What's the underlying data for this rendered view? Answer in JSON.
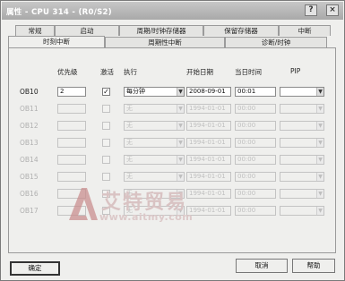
{
  "window": {
    "title": "属性 - CPU 314 - (R0/S2)"
  },
  "tabs_back": [
    "常规",
    "启动",
    "周期/时钟存储器",
    "保留存储器",
    "中断"
  ],
  "tabs_front": [
    "时刻中断",
    "周期性中断",
    "诊断/时钟"
  ],
  "headers": {
    "priority": "优先级",
    "activate": "激活",
    "execute": "执行",
    "start_date": "开始日期",
    "time_of_day": "当日时间",
    "pip": "PIP"
  },
  "rows": [
    {
      "label": "OB10",
      "priority": "2",
      "active": true,
      "execution": "每分钟",
      "date": "2008-09-01",
      "time": "00:01",
      "pip": "",
      "enabled": true
    },
    {
      "label": "OB11",
      "priority": "",
      "active": false,
      "execution": "无",
      "date": "1994-01-01",
      "time": "00:00",
      "pip": "",
      "enabled": false
    },
    {
      "label": "OB12",
      "priority": "",
      "active": false,
      "execution": "无",
      "date": "1994-01-01",
      "time": "00:00",
      "pip": "",
      "enabled": false
    },
    {
      "label": "OB13",
      "priority": "",
      "active": false,
      "execution": "无",
      "date": "1994-01-01",
      "time": "00:00",
      "pip": "",
      "enabled": false
    },
    {
      "label": "OB14",
      "priority": "",
      "active": false,
      "execution": "无",
      "date": "1994-01-01",
      "time": "00:00",
      "pip": "",
      "enabled": false
    },
    {
      "label": "OB15",
      "priority": "",
      "active": false,
      "execution": "无",
      "date": "1994-01-01",
      "time": "00:00",
      "pip": "",
      "enabled": false
    },
    {
      "label": "OB16",
      "priority": "",
      "active": false,
      "execution": "无",
      "date": "1994-01-01",
      "time": "00:00",
      "pip": "",
      "enabled": false
    },
    {
      "label": "OB17",
      "priority": "",
      "active": false,
      "execution": "无",
      "date": "1994-01-01",
      "time": "00:00",
      "pip": "",
      "enabled": false
    }
  ],
  "buttons": {
    "ok": "确定",
    "cancel": "取消",
    "help": "帮助"
  },
  "watermark": {
    "text": "艾特贸易",
    "url": "www.aitmy.com"
  },
  "colors": {
    "title_bar": "#b3b3b3",
    "watermark": "#d9c3c3",
    "watermark_logo": "#c98f8f"
  }
}
